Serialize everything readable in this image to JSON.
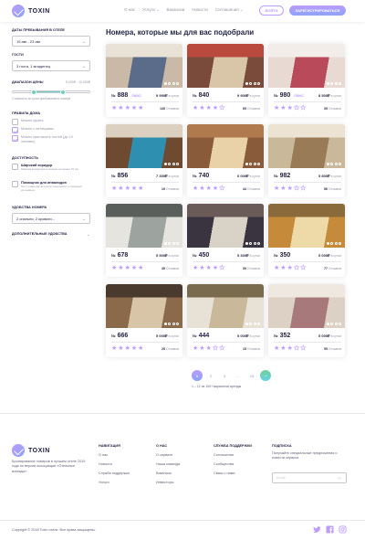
{
  "header": {
    "logo_text": "TOXIN",
    "nav": [
      {
        "label": "О нас",
        "has_dropdown": false
      },
      {
        "label": "Услуги",
        "has_dropdown": true
      },
      {
        "label": "Вакансии",
        "has_dropdown": false
      },
      {
        "label": "Новости",
        "has_dropdown": false
      },
      {
        "label": "Соглашения",
        "has_dropdown": true
      }
    ],
    "login_label": "ВОЙТИ",
    "register_label": "ЗАРЕГИСТРИРОВАТЬСЯ"
  },
  "filters": {
    "dates_label": "ДАТЫ ПРЕБЫВАНИЯ В ОТЕЛЕ",
    "dates_value": "19 авг - 23 авг",
    "guests_label": "ГОСТИ",
    "guests_value": "3 гостя, 1 младенец",
    "price_label": "ДИАПАЗОН ЦЕНЫ",
    "price_value": "5 000₽ - 10 000₽",
    "price_range_fraction": [
      0.26,
      0.64
    ],
    "price_hint": "Стоимость за сутки пребывания в номере",
    "rules_label": "ПРАВИЛА ДОМА",
    "rules": [
      {
        "label": "Можно курить",
        "checked": false
      },
      {
        "label": "Можно с питомцами",
        "checked": true
      },
      {
        "label": "Можно пригласить гостей (до 10 человек)",
        "checked": true
      }
    ],
    "access_label": "ДОСТУПНОСТЬ",
    "access": [
      {
        "title": "Широкий коридор",
        "desc": "Ширина коридоров в номере не менее 91 см.",
        "checked": false
      },
      {
        "title": "Помощник для инвалидов",
        "desc": "На 1 этаже вас встретит специалист и проводит до номера.",
        "checked": false
      }
    ],
    "comfort_label": "УДОБСТВА НОМЕРА",
    "comfort_value": "2 спальни, 2 кровати...",
    "extra_label": "ДОПОЛНИТЕЛЬНЫЕ УДОБСТВА"
  },
  "main": {
    "title": "Номера, которые мы для вас подобрали",
    "rooms": [
      {
        "number": "888",
        "lux": "ЛЮКС",
        "price": "9 990₽",
        "per": "в сутки",
        "rating": 5,
        "reviews": "145",
        "reviews_word": "Отзывов",
        "photo": [
          "#c9b9a6",
          "#5b6c8a",
          "#e9e2d6"
        ]
      },
      {
        "number": "840",
        "lux": "",
        "price": "9 900₽",
        "per": "в сутки",
        "rating": 4,
        "reviews": "65",
        "reviews_word": "Отзывов",
        "photo": [
          "#7a4a3a",
          "#d9c6a8",
          "#b94a3d"
        ]
      },
      {
        "number": "980",
        "lux": "ЛЮКС",
        "price": "8 500₽",
        "per": "в сутки",
        "rating": 3,
        "reviews": "35",
        "reviews_word": "Отзывов",
        "photo": [
          "#e8d9d3",
          "#b84a5a",
          "#f3ede9"
        ]
      },
      {
        "number": "856",
        "lux": "",
        "price": "7 300₽",
        "per": "в сутки",
        "rating": 5,
        "reviews": "19",
        "reviews_word": "Отзывов",
        "photo": [
          "#6e4a30",
          "#2f8fb0",
          "#dcd1c1"
        ]
      },
      {
        "number": "740",
        "lux": "",
        "price": "6 000₽",
        "per": "в сутки",
        "rating": 4,
        "reviews": "44",
        "reviews_word": "Отзывов",
        "photo": [
          "#8a5b3a",
          "#e9d2a8",
          "#b07a4e"
        ]
      },
      {
        "number": "982",
        "lux": "",
        "price": "5 800₽",
        "per": "в сутки",
        "rating": 3,
        "reviews": "56",
        "reviews_word": "Отзывов",
        "photo": [
          "#c9b89a",
          "#9a7b58",
          "#ece3d3"
        ]
      },
      {
        "number": "678",
        "lux": "",
        "price": "5 500₽",
        "per": "в сутки",
        "rating": 5,
        "reviews": "45",
        "reviews_word": "Отзывов",
        "photo": [
          "#e6e4df",
          "#9da39f",
          "#5a5f5c"
        ]
      },
      {
        "number": "450",
        "lux": "",
        "price": "5 300₽",
        "per": "в сутки",
        "rating": 4,
        "reviews": "39",
        "reviews_word": "Отзывов",
        "photo": [
          "#3a3440",
          "#d9d2c6",
          "#6a5a58"
        ]
      },
      {
        "number": "350",
        "lux": "",
        "price": "5 000₽",
        "per": "в сутки",
        "rating": 3,
        "reviews": "77",
        "reviews_word": "Отзывов",
        "photo": [
          "#c58a3a",
          "#eed9a8",
          "#8a6a3a"
        ]
      },
      {
        "number": "666",
        "lux": "",
        "price": "5 000₽",
        "per": "в сутки",
        "rating": 5,
        "reviews": "25",
        "reviews_word": "Отзывов",
        "photo": [
          "#8a6a4a",
          "#d8c4a6",
          "#4a3a2e"
        ]
      },
      {
        "number": "444",
        "lux": "",
        "price": "5 000₽",
        "per": "в сутки",
        "rating": 3,
        "reviews": "15",
        "reviews_word": "Отзывов",
        "photo": [
          "#e8e2d6",
          "#c9b99a",
          "#7a6a4e"
        ]
      },
      {
        "number": "352",
        "lux": "",
        "price": "5 000₽",
        "per": "в сутки",
        "rating": 3,
        "reviews": "55",
        "reviews_word": "Отзывов",
        "photo": [
          "#ddd0c4",
          "#a8797a",
          "#efe8e1"
        ]
      }
    ],
    "room_prefix": "№",
    "pager": [
      "1",
      "2",
      "3",
      "...",
      "15"
    ],
    "pager_info": "1 – 12 из 100+ вариантов аренды"
  },
  "footer": {
    "logo_text": "TOXIN",
    "desc": "Бронирование номеров в лучшем отеле 2019 года по версии ассоциации «Отельные взгляды»",
    "cols": [
      {
        "title": "НАВИГАЦИЯ",
        "items": [
          "О нас",
          "Новости",
          "Служба поддержки",
          "Услуги"
        ]
      },
      {
        "title": "О НАС",
        "items": [
          "О сервисе",
          "Наша команда",
          "Вакансии",
          "Инвесторы"
        ]
      },
      {
        "title": "СЛУЖБА ПОДДЕРЖКИ",
        "items": [
          "Соглашения",
          "Сообщества",
          "Связь с нами"
        ]
      }
    ],
    "sub_title": "ПОДПИСКА",
    "sub_text": "Получайте специальные предложения и новости сервиса",
    "sub_placeholder": "Email",
    "copyright": "Copyright © 2018 Toxin отель. Все права защищены.",
    "social": [
      "twitter-icon",
      "facebook-icon",
      "instagram-icon"
    ],
    "accent": "#bc9cff",
    "accent2": "#8ba4f9",
    "green": "#6fcf97"
  }
}
